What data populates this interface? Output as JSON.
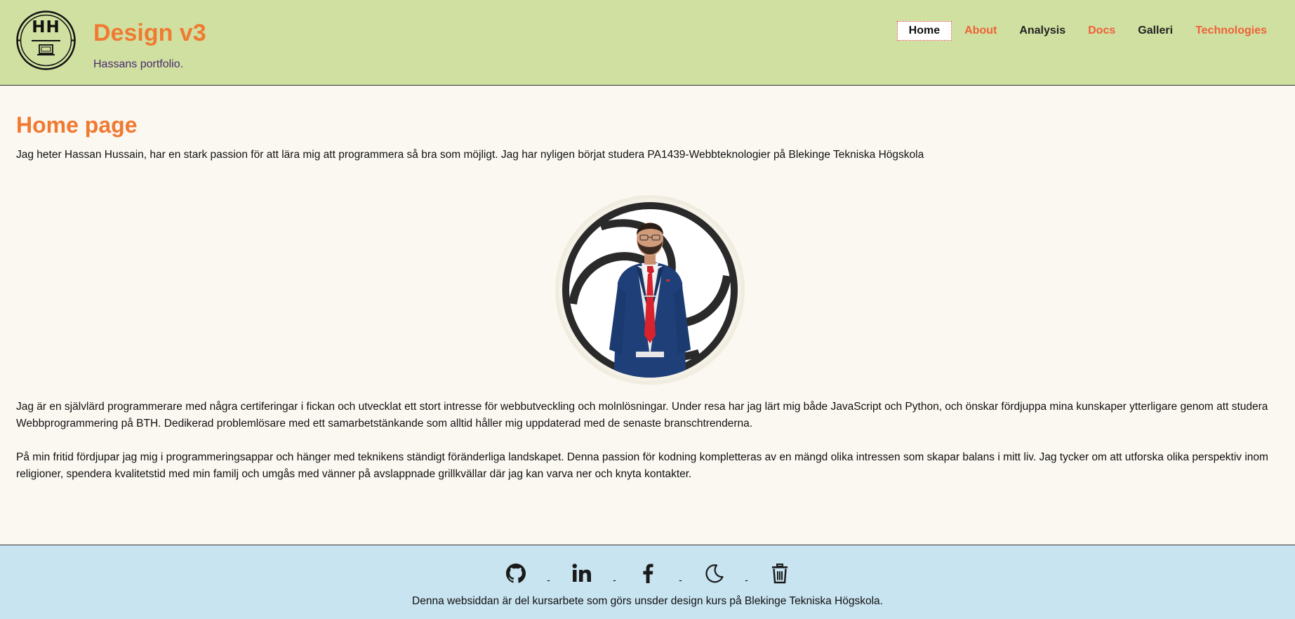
{
  "header": {
    "logo_text": "HH",
    "title": "Design v3",
    "slogan": "Hassans portfolio."
  },
  "nav": {
    "items": [
      {
        "label": "Home",
        "active": true
      },
      {
        "label": "About"
      },
      {
        "label": "Analysis"
      },
      {
        "label": "Docs"
      },
      {
        "label": "Galleri"
      },
      {
        "label": "Technologies"
      }
    ]
  },
  "main": {
    "heading": "Home page",
    "intro": "Jag heter Hassan Hussain, har en stark passion för att lära mig att programmera så bra som möjligt. Jag har nyligen börjat studera PA1439-Webbteknologier på Blekinge Tekniska Högskola",
    "paragraph_2": "Jag är en självlärd programmerare med några certiferingar i fickan och utvecklat ett stort intresse för webbutveckling och molnlösningar. Under resa har jag lärt mig både JavaScript och Python, och önskar fördjuppa mina kunskaper ytterligare genom att studera Webbprogrammering på BTH. Dedikerad problemlösare med ett samarbetstänkande som alltid håller mig uppdaterad med de senaste branschtrenderna.",
    "paragraph_3": "På min fritid fördjupar jag mig i programmeringsappar och hänger med teknikens ständigt föränderliga landskapet. Denna passion för kodning kompletteras av en mängd olika intressen som skapar balans i mitt liv. Jag tycker om att utforska olika perspektiv inom religioner, spendera kvalitetstid med min familj och umgås med vänner på avslappnade grillkvällar där jag kan varva ner och knyta kontakter."
  },
  "footer": {
    "icons": [
      "github-icon",
      "linkedin-icon",
      "facebook-icon",
      "moon-icon",
      "trash-icon"
    ],
    "separator": "-",
    "text": "Denna websiddan är del kursarbete som görs unsder design kurs på Blekinge Tekniska Högskola."
  },
  "colors": {
    "header_bg": "#d0e0a0",
    "footer_bg": "#c8e4f0",
    "page_bg": "#fbf8f1",
    "accent_orange": "#f07a32",
    "nav_orange": "#f0603a",
    "slogan_purple": "#4a2a6e"
  }
}
